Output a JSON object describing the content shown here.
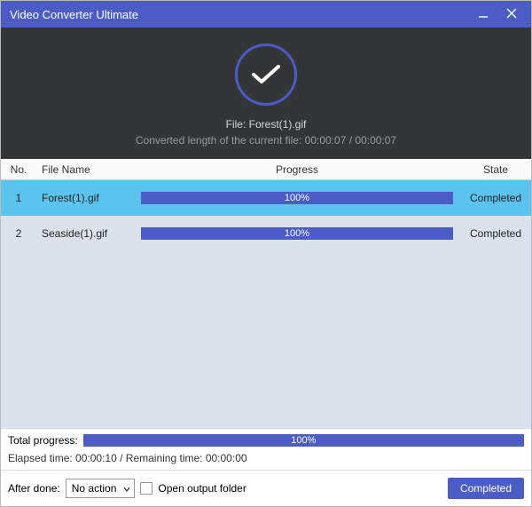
{
  "window": {
    "title": "Video Converter Ultimate"
  },
  "hero": {
    "file_label_prefix": "File: ",
    "file_name": "Forest(1).gif",
    "len_label_prefix": "Converted length of the current file: ",
    "len_current": "00:00:07",
    "len_sep": " / ",
    "len_total": "00:00:07"
  },
  "columns": {
    "no": "No.",
    "name": "File Name",
    "progress": "Progress",
    "state": "State"
  },
  "rows": [
    {
      "no": "1",
      "name": "Forest(1).gif",
      "pct": "100%",
      "state": "Completed",
      "selected": true
    },
    {
      "no": "2",
      "name": "Seaside(1).gif",
      "pct": "100%",
      "state": "Completed",
      "selected": false
    }
  ],
  "total": {
    "label": "Total progress:",
    "pct": "100%"
  },
  "time": {
    "elapsed_label": "Elapsed time: ",
    "elapsed": "00:00:10",
    "sep": " / ",
    "remain_label": "Remaining time: ",
    "remain": "00:00:00"
  },
  "action": {
    "after_done_label": "After done:",
    "after_done_value": "No action",
    "open_folder_label": "Open output folder",
    "completed_button": "Completed"
  }
}
